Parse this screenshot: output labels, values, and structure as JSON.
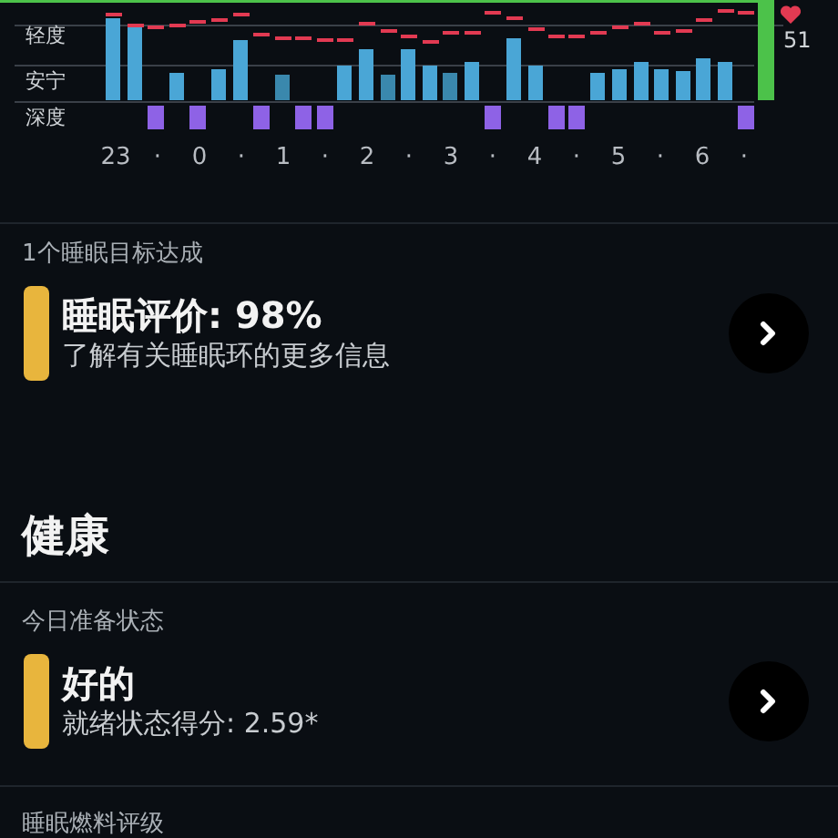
{
  "sleep_chart": {
    "stage_labels": [
      "轻度",
      "安宁",
      "深度"
    ],
    "time_labels": [
      "23",
      "·",
      "0",
      "·",
      "1",
      "·",
      "2",
      "·",
      "3",
      "·",
      "4",
      "·",
      "5",
      "·",
      "6",
      "·"
    ],
    "heart_rate": "51"
  },
  "sleep_goal": {
    "caption": "1个睡眠目标达成",
    "title": "睡眠评价: 98%",
    "subtitle": "了解有关睡眠环的更多信息",
    "color": "#e8b53d"
  },
  "health": {
    "heading": "健康",
    "readiness": {
      "caption": "今日准备状态",
      "title": "好的",
      "subtitle": "就绪状态得分: 2.59*",
      "color": "#e8b53d"
    },
    "next_caption": "睡眠燃料评级"
  }
}
